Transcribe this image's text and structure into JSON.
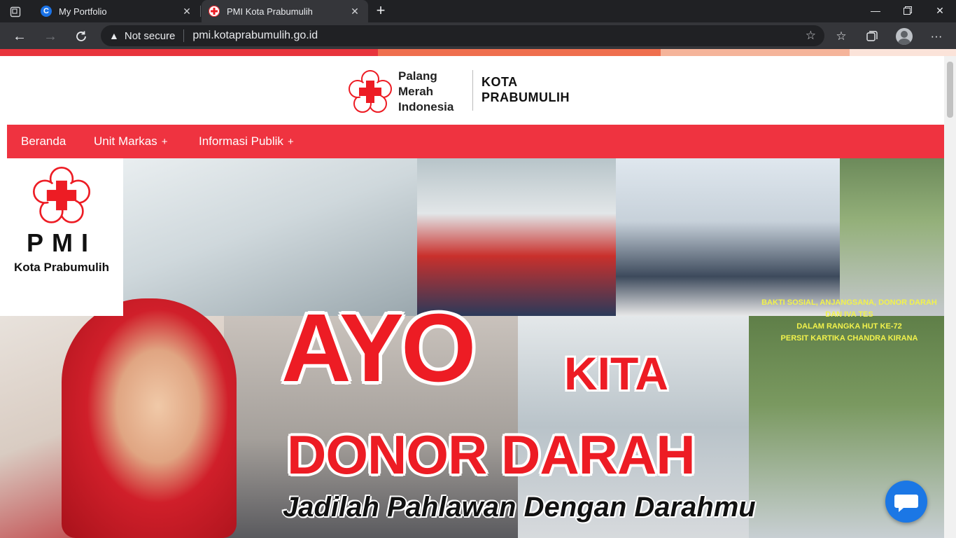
{
  "browser": {
    "tabs": [
      {
        "title": "My Portfolio",
        "favicon": "C"
      },
      {
        "title": "PMI Kota Prabumulih",
        "favicon": "pmi-flower-icon"
      }
    ],
    "security_label": "Not secure",
    "url": "pmi.kotaprabumulih.go.id"
  },
  "colors": {
    "brand_red": "#ef3340",
    "slogan_red": "#ed1c24",
    "chat_blue": "#1b77e5",
    "chrome_dark": "#202124"
  },
  "header": {
    "org_name": [
      "Palang",
      "Merah",
      "Indonesia"
    ],
    "city_name": [
      "KOTA",
      "PRABUMULIH"
    ]
  },
  "nav": {
    "items": [
      {
        "label": "Beranda",
        "has_submenu": false
      },
      {
        "label": "Unit Markas",
        "has_submenu": true
      },
      {
        "label": "Informasi Publik",
        "has_submenu": true
      }
    ]
  },
  "hero": {
    "card_title": "PMI",
    "card_subtitle": "Kota Prabumulih",
    "headline_1": "AYO",
    "headline_2": "KITA",
    "headline_3": "DONOR DARAH",
    "tagline": "Jadilah Pahlawan Dengan Darahmu",
    "banner_1": "BAKTI SOSIAL, ANJANGSANA, DONOR DARAH DAN IVA TES",
    "banner_2": "DALAM RANGKA HUT KE-72",
    "banner_3": "PERSIT KARTIKA CHANDRA KIRANA"
  }
}
